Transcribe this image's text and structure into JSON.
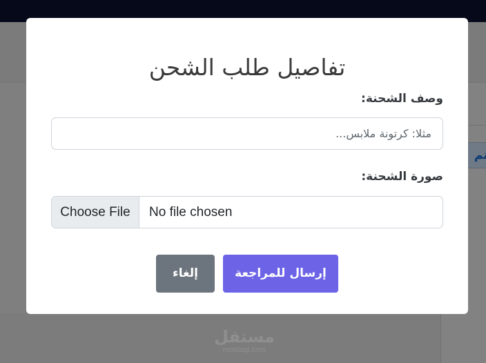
{
  "modal": {
    "title": "تفاصيل طلب الشحن",
    "description_label": "وصف الشحنة:",
    "description_placeholder": "مثلا: كرتونة ملابس...",
    "description_value": "",
    "photo_label": "صورة الشحنة:",
    "file_button_label": "Choose File",
    "file_status": "No file chosen",
    "submit_label": "إرسال للمراجعة",
    "cancel_label": "إلغاء"
  },
  "background": {
    "partial_tab_text": "تم"
  },
  "watermark": {
    "arabic": "مستقل",
    "latin": "mostaql.com"
  },
  "colors": {
    "submit": "#6c63e6",
    "cancel": "#6c757d",
    "topbar": "#05091a"
  }
}
